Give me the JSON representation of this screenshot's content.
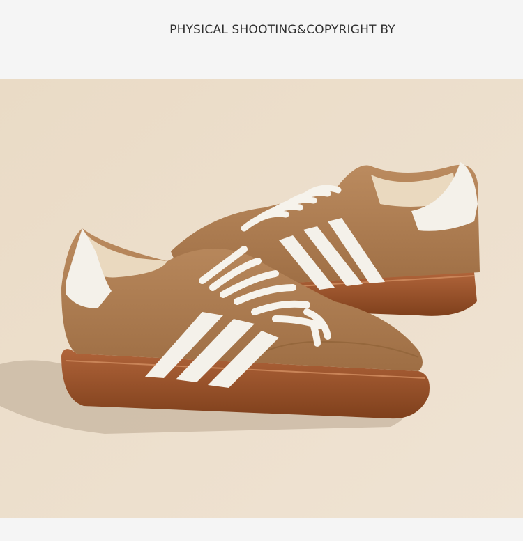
{
  "header": {
    "title": "PHYSICAL SHOOTING&COPYRIGHT BY"
  },
  "photo": {
    "subject": "product-photo-sneakers",
    "colors": {
      "background": "#ebdcc9",
      "suede": "#b07f52",
      "suede_dark": "#8f6238",
      "sole": "#a65a2e",
      "sole_dark": "#7e3f1c",
      "stripe": "#f4f1ea",
      "lining": "#e8d8c0",
      "shadow": "#bfae98"
    }
  }
}
